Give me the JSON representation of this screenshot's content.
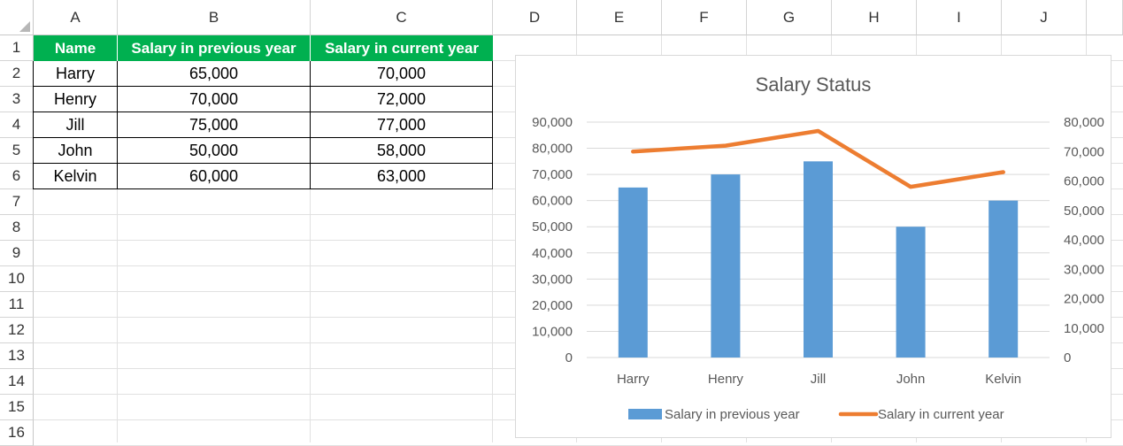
{
  "sheet": {
    "columns": [
      "A",
      "B",
      "C",
      "D",
      "E",
      "F",
      "G",
      "H",
      "I",
      "J"
    ],
    "rows": [
      "1",
      "2",
      "3",
      "4",
      "5",
      "6",
      "7",
      "8",
      "9",
      "10",
      "11",
      "12",
      "13",
      "14",
      "15",
      "16"
    ]
  },
  "table": {
    "headers": [
      "Name",
      "Salary in previous year",
      "Salary in current year"
    ],
    "rows": [
      [
        "Harry",
        "65,000",
        "70,000"
      ],
      [
        "Henry",
        "70,000",
        "72,000"
      ],
      [
        "Jill",
        "75,000",
        "77,000"
      ],
      [
        "John",
        "50,000",
        "58,000"
      ],
      [
        "Kelvin",
        "60,000",
        "63,000"
      ]
    ]
  },
  "chart_data": {
    "type": "bar",
    "title": "Salary Status",
    "categories": [
      "Harry",
      "Henry",
      "Jill",
      "John",
      "Kelvin"
    ],
    "series": [
      {
        "name": "Salary in previous year",
        "type": "bar",
        "axis": "primary",
        "color": "#5b9bd5",
        "values": [
          65000,
          70000,
          75000,
          50000,
          60000
        ]
      },
      {
        "name": "Salary in current year",
        "type": "line",
        "axis": "secondary",
        "color": "#ed7d31",
        "values": [
          70000,
          72000,
          77000,
          58000,
          63000
        ]
      }
    ],
    "primary_axis": {
      "min": 0,
      "max": 90000,
      "ticks": [
        "0",
        "10,000",
        "20,000",
        "30,000",
        "40,000",
        "50,000",
        "60,000",
        "70,000",
        "80,000",
        "90,000"
      ]
    },
    "secondary_axis": {
      "min": 0,
      "max": 80000,
      "ticks": [
        "0",
        "10,000",
        "20,000",
        "30,000",
        "40,000",
        "50,000",
        "60,000",
        "70,000",
        "80,000"
      ]
    },
    "grid": true,
    "legend_position": "bottom"
  }
}
